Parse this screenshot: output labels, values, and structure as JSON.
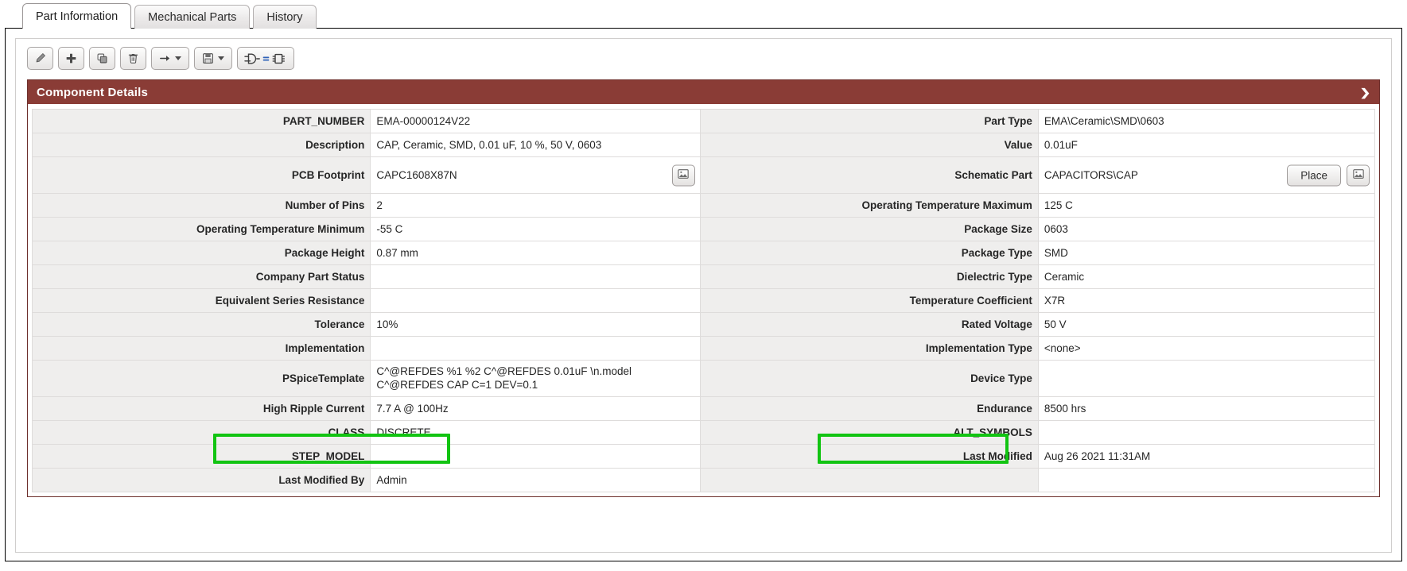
{
  "tabs": [
    {
      "label": "Part Information",
      "active": true
    },
    {
      "label": "Mechanical Parts",
      "active": false
    },
    {
      "label": "History",
      "active": false
    }
  ],
  "toolbar": {
    "buttons": [
      {
        "name": "edit-button",
        "icon": "pencil-icon"
      },
      {
        "name": "add-button",
        "icon": "plus-icon"
      },
      {
        "name": "copy-button",
        "icon": "copy-icon"
      },
      {
        "name": "delete-button",
        "icon": "trash-icon"
      },
      {
        "name": "move-to-button",
        "icon": "arrow-right-icon"
      },
      {
        "name": "save-button",
        "icon": "save-icon"
      },
      {
        "name": "symbol-mapping-button",
        "icon": "gate-equals-chip-icon"
      }
    ]
  },
  "card": {
    "title": "Component Details",
    "collapse_icon": "chevron-down-icon"
  },
  "buttons": {
    "place_label": "Place",
    "footprint_view_icon": "picture-icon",
    "symbol_view_icon": "picture-icon"
  },
  "properties": {
    "left": [
      {
        "label": "PART_NUMBER",
        "value": "EMA-00000124V22"
      },
      {
        "label": "Description",
        "value": "CAP, Ceramic, SMD, 0.01 uF, 10 %, 50 V, 0603"
      },
      {
        "label": "PCB Footprint",
        "value": "CAPC1608X87N"
      },
      {
        "label": "Number of Pins",
        "value": "2"
      },
      {
        "label": "Operating Temperature Minimum",
        "value": "-55 C"
      },
      {
        "label": "Package Height",
        "value": "0.87 mm"
      },
      {
        "label": "Company Part Status",
        "value": ""
      },
      {
        "label": "Equivalent Series Resistance",
        "value": ""
      },
      {
        "label": "Tolerance",
        "value": "10%"
      },
      {
        "label": "Implementation",
        "value": ""
      },
      {
        "label": "PSpiceTemplate",
        "value": "C^@REFDES %1 %2 C^@REFDES 0.01uF \\n.model C^@REFDES CAP C=1 DEV=0.1"
      },
      {
        "label": "High Ripple Current",
        "value": "7.7 A @ 100Hz"
      },
      {
        "label": "CLASS",
        "value": "DISCRETE"
      },
      {
        "label": "STEP_MODEL",
        "value": ""
      },
      {
        "label": "Last Modified By",
        "value": "Admin"
      }
    ],
    "right": [
      {
        "label": "Part Type",
        "value": "EMA\\Ceramic\\SMD\\0603"
      },
      {
        "label": "Value",
        "value": "0.01uF"
      },
      {
        "label": "Schematic Part",
        "value": "CAPACITORS\\CAP"
      },
      {
        "label": "Operating Temperature Maximum",
        "value": "125 C"
      },
      {
        "label": "Package Size",
        "value": "0603"
      },
      {
        "label": "Package Type",
        "value": "SMD"
      },
      {
        "label": "Dielectric Type",
        "value": "Ceramic"
      },
      {
        "label": "Temperature Coefficient",
        "value": "X7R"
      },
      {
        "label": "Rated Voltage",
        "value": "50 V"
      },
      {
        "label": "Implementation Type",
        "value": "<none>"
      },
      {
        "label": "Device Type",
        "value": ""
      },
      {
        "label": "Endurance",
        "value": "8500 hrs"
      },
      {
        "label": "ALT_SYMBOLS",
        "value": ""
      },
      {
        "label": "Last Modified",
        "value": "Aug 26 2021 11:31AM"
      },
      {
        "label": "",
        "value": ""
      }
    ]
  },
  "highlights": [
    {
      "name": "highlight-high-ripple-current",
      "color": "#12c412"
    },
    {
      "name": "highlight-endurance",
      "color": "#12c412"
    }
  ]
}
